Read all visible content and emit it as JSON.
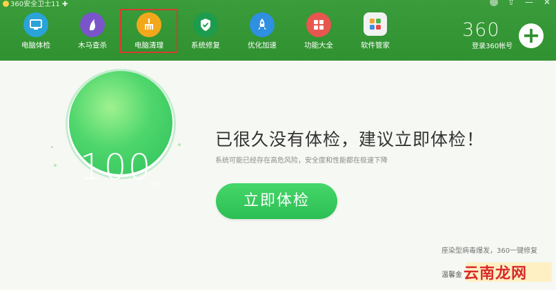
{
  "app": {
    "title": "360安全卫士11"
  },
  "nav": {
    "items": [
      {
        "label": "电脑体检",
        "color": "#2aa3d8",
        "icon": "monitor-icon"
      },
      {
        "label": "木马查杀",
        "color": "#7a55c9",
        "icon": "horse-icon"
      },
      {
        "label": "电脑清理",
        "color": "#f3a81c",
        "icon": "broom-icon"
      },
      {
        "label": "系统修复",
        "color": "#1d9c4e",
        "icon": "shield-icon"
      },
      {
        "label": "优化加速",
        "color": "#2f8fe0",
        "icon": "rocket-icon"
      },
      {
        "label": "功能大全",
        "color": "#e8574f",
        "icon": "grid-icon"
      },
      {
        "label": "软件管家",
        "color": "#f2f2f2",
        "icon": "apps-icon"
      }
    ]
  },
  "account": {
    "logo": "360",
    "login_label": "登录360帐号",
    "plus": "+"
  },
  "main": {
    "score": "100",
    "score_unit": "分",
    "headline": "已很久没有体检，建议立即体检！",
    "subline": "系统可能已经存在高危风险，安全度和性能都在极速下降",
    "check_button": "立即体检",
    "promo_text": "座染型病毒爆发，360一键修复",
    "bottom_prefix": "温馨金"
  },
  "watermark": "云南龙网",
  "colors": {
    "header": "#2f912f",
    "accent": "#2cbf53",
    "active_outline": "#d83a34"
  }
}
